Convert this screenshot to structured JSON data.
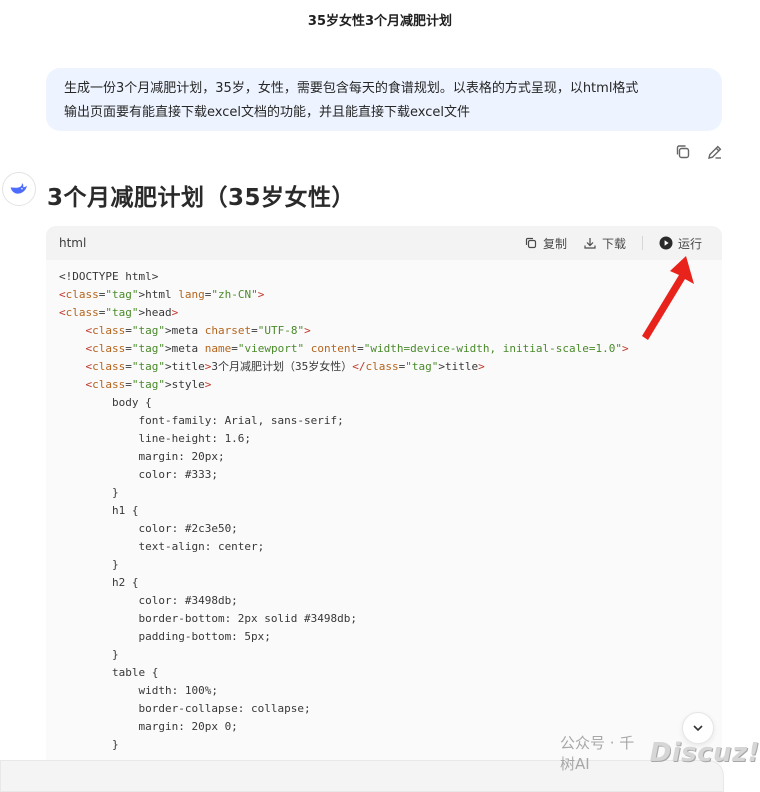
{
  "conversation": {
    "title": "35岁女性3个月减肥计划"
  },
  "user_message": {
    "line1": "生成一份3个月减肥计划，35岁，女性，需要包含每天的食谱规划。以表格的方式呈现，以html格式",
    "line2": "输出页面要有能直接下载excel文档的功能，并且能直接下载excel文件"
  },
  "reply": {
    "heading": "3个月减肥计划（35岁女性）",
    "code_block": {
      "language": "html",
      "copy_label": "复制",
      "download_label": "下载",
      "run_label": "运行",
      "lines": [
        "<!DOCTYPE html>",
        "<html lang=\"zh-CN\">",
        "<head>",
        "    <meta charset=\"UTF-8\">",
        "    <meta name=\"viewport\" content=\"width=device-width, initial-scale=1.0\">",
        "    <title>3个月减肥计划（35岁女性）</title>",
        "    <style>",
        "        body {",
        "            font-family: Arial, sans-serif;",
        "            line-height: 1.6;",
        "            margin: 20px;",
        "            color: #333;",
        "        }",
        "        h1 {",
        "            color: #2c3e50;",
        "            text-align: center;",
        "        }",
        "        h2 {",
        "            color: #3498db;",
        "            border-bottom: 2px solid #3498db;",
        "            padding-bottom: 5px;",
        "        }",
        "        table {",
        "            width: 100%;",
        "            border-collapse: collapse;",
        "            margin: 20px 0;",
        "        }"
      ]
    }
  },
  "watermark": {
    "prefix": "公众号 · 千树AI",
    "logo": "Discuz!"
  },
  "colors": {
    "user_bubble": "#eef4ff",
    "arrow": "#e8231b",
    "code_bg": "#fafafa"
  },
  "icons": {
    "copy_message": "copy-icon",
    "edit_message": "pencil-icon",
    "assistant": "whale-icon",
    "copy_code": "copy-icon",
    "download": "download-icon",
    "run": "play-icon",
    "scroll_down": "chevron-down-icon"
  }
}
